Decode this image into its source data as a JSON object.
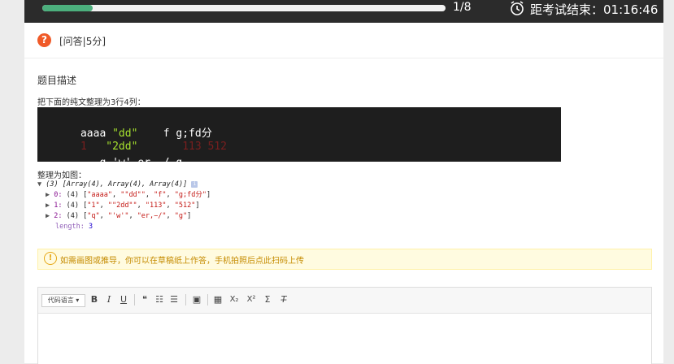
{
  "progress": {
    "text": "1/8",
    "fraction": 0.125
  },
  "timer": {
    "text": "距考试结束：01:16:46"
  },
  "question": {
    "icon": "?",
    "type": "[问答|5分]"
  },
  "section_title": "题目描述",
  "instruction": "把下面的纯文整理为3行4列：",
  "code_lines": [
    {
      "parts": [
        {
          "t": "aaaa ",
          "c": "plain"
        },
        {
          "t": "\"dd\"",
          "c": "str"
        },
        {
          "t": "    f g;fd分",
          "c": "plain"
        }
      ]
    },
    {
      "parts": [
        {
          "t": "1   ",
          "c": "dim"
        },
        {
          "t": "\"2dd\"",
          "c": "str"
        },
        {
          "t": "       113 512",
          "c": "dim"
        }
      ]
    },
    {
      "parts": [
        {
          "t": "   q 'w' er,−/ g",
          "c": "plain"
        }
      ]
    }
  ],
  "result_label": "整理为如图：",
  "console": {
    "summary": "(3) [Array(4), Array(4), Array(4)]",
    "rows": [
      {
        "idx": "0:",
        "len": "(4)",
        "vals": [
          "\"aaaa\"",
          "\"\"dd\"\"",
          "\"f\"",
          "\"g;fd分\""
        ]
      },
      {
        "idx": "1:",
        "len": "(4)",
        "vals": [
          "\"1\"",
          "\"\"2dd\"\"",
          "\"113\"",
          "\"512\""
        ]
      },
      {
        "idx": "2:",
        "len": "(4)",
        "vals": [
          "\"q\"",
          "\"'w'\"",
          "\"er,−/\"",
          "\"g\""
        ]
      }
    ],
    "length_key": "length:",
    "length_val": "3"
  },
  "tip": {
    "icon": "!",
    "text": "如需画图或推导，你可以在草稿纸上作答，手机拍照后",
    "link": "点此扫码上传"
  },
  "toolbar": {
    "code_lang": "代码语言",
    "bold": "B",
    "italic": "I",
    "underline": "U",
    "quote": "❝",
    "ordered_list": "☷",
    "unordered_list": "☰",
    "image": "▣",
    "table": "▦",
    "subscript": "X₂",
    "superscript": "X²",
    "formula": "Σ",
    "clear_format": "T̶"
  }
}
